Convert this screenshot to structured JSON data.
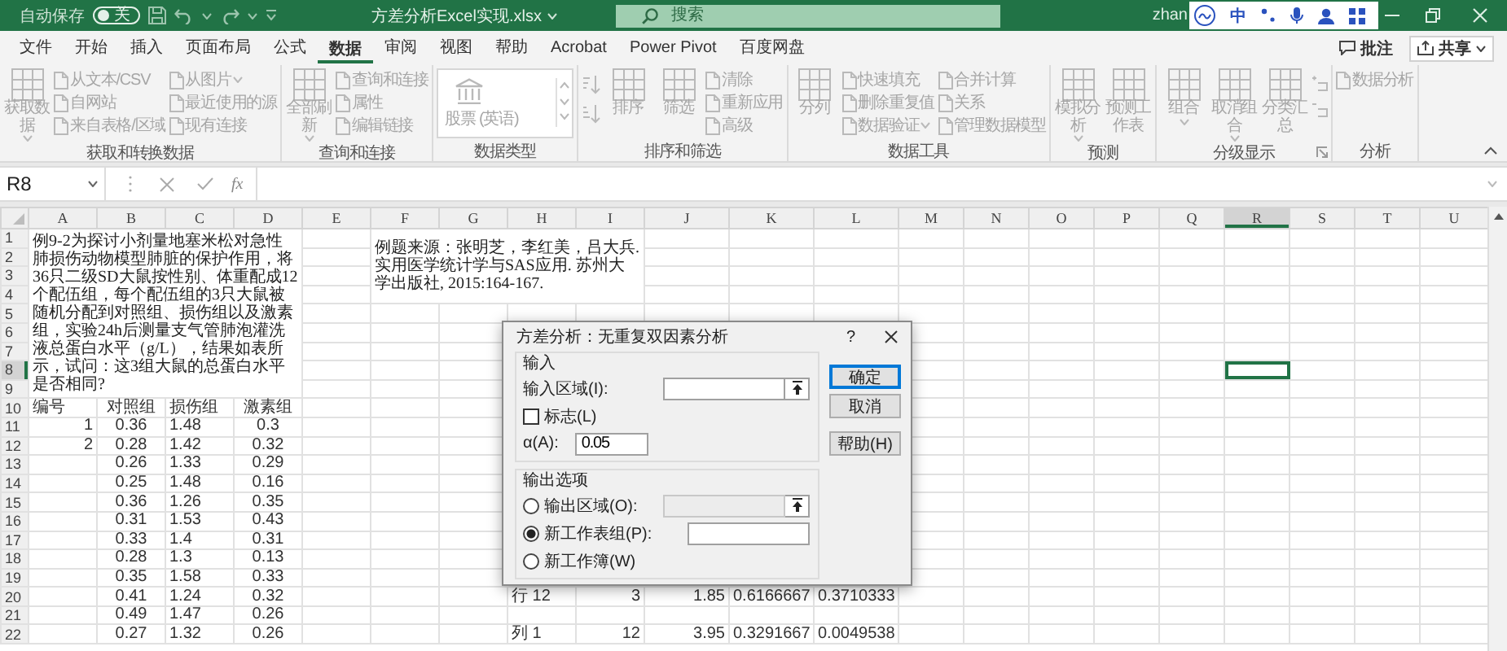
{
  "title_bar": {
    "autosave_label": "自动保存",
    "autosave_toggle": {
      "on": false,
      "label": "关"
    },
    "document_title": "方差分析Excel实现.xlsx",
    "search_placeholder": "搜索",
    "user": "zhan",
    "ime_mode": "中"
  },
  "menu_tabs": [
    {
      "label": "文件",
      "selected": false
    },
    {
      "label": "开始",
      "selected": false
    },
    {
      "label": "插入",
      "selected": false
    },
    {
      "label": "页面布局",
      "selected": false
    },
    {
      "label": "公式",
      "selected": false
    },
    {
      "label": "数据",
      "selected": true
    },
    {
      "label": "审阅",
      "selected": false
    },
    {
      "label": "视图",
      "selected": false
    },
    {
      "label": "帮助",
      "selected": false
    },
    {
      "label": "Acrobat",
      "selected": false
    },
    {
      "label": "Power Pivot",
      "selected": false
    },
    {
      "label": "百度网盘",
      "selected": false
    }
  ],
  "actions": [
    {
      "label": "批注",
      "kind": "comment"
    },
    {
      "label": "共享",
      "kind": "share"
    }
  ],
  "ribbon": {
    "disabled": true,
    "groups": [
      {
        "label": "获取和转换数据",
        "items": [
          {
            "kind": "large",
            "label": "获取数据",
            "dropdown": true
          },
          {
            "kind": "stack",
            "items": [
              {
                "label": "从文本/CSV"
              },
              {
                "label": "自网站"
              },
              {
                "label": "来自表格/区域"
              }
            ]
          },
          {
            "kind": "stack",
            "items": [
              {
                "label": "从图片",
                "dropdown": true
              },
              {
                "label": "最近使用的源"
              },
              {
                "label": "现有连接"
              }
            ]
          }
        ]
      },
      {
        "label": "查询和连接",
        "items": [
          {
            "kind": "large",
            "label": "全部刷新",
            "dropdown": true
          },
          {
            "kind": "stack",
            "items": [
              {
                "label": "查询和连接"
              },
              {
                "label": "属性"
              },
              {
                "label": "编辑链接"
              }
            ]
          }
        ]
      },
      {
        "label": "数据类型",
        "items": [
          {
            "kind": "gallery",
            "label": "股票 (英语)"
          }
        ]
      },
      {
        "label": "排序和筛选",
        "items": [
          {
            "kind": "sort-icons"
          },
          {
            "kind": "large",
            "label": "排序"
          },
          {
            "kind": "large",
            "label": "筛选"
          },
          {
            "kind": "stack",
            "items": [
              {
                "label": "清除"
              },
              {
                "label": "重新应用"
              },
              {
                "label": "高级"
              }
            ]
          }
        ]
      },
      {
        "label": "数据工具",
        "items": [
          {
            "kind": "large",
            "label": "分列"
          },
          {
            "kind": "stack",
            "items": [
              {
                "label": "快速填充"
              },
              {
                "label": "删除重复值"
              },
              {
                "label": "数据验证",
                "dropdown": true
              }
            ]
          },
          {
            "kind": "stack",
            "items": [
              {
                "label": "合并计算"
              },
              {
                "label": "关系"
              },
              {
                "label": "管理数据模型"
              }
            ]
          }
        ]
      },
      {
        "label": "预测",
        "items": [
          {
            "kind": "large",
            "label": "模拟分析",
            "dropdown": true
          },
          {
            "kind": "large",
            "label": "预测工作表"
          }
        ]
      },
      {
        "label": "分级显示",
        "dialog_launcher": true,
        "items": [
          {
            "kind": "large",
            "label": "组合",
            "dropdown": true
          },
          {
            "kind": "large",
            "label": "取消组合",
            "dropdown": true
          },
          {
            "kind": "large",
            "label": "分类汇总"
          },
          {
            "kind": "detail-icons"
          }
        ]
      },
      {
        "label": "分析",
        "items": [
          {
            "kind": "stack",
            "items": [
              {
                "label": "数据分析"
              }
            ]
          }
        ]
      }
    ]
  },
  "formula_bar": {
    "name_box": "R8",
    "function_button": "fx"
  },
  "sheet": {
    "columns": [
      {
        "label": "A",
        "selected": false
      },
      {
        "label": "B",
        "selected": false
      },
      {
        "label": "C",
        "selected": false
      },
      {
        "label": "D",
        "selected": false
      },
      {
        "label": "E",
        "selected": false
      },
      {
        "label": "F",
        "selected": false
      },
      {
        "label": "G",
        "selected": false
      },
      {
        "label": "H",
        "selected": false
      },
      {
        "label": "I",
        "selected": false
      },
      {
        "label": "J",
        "selected": false
      },
      {
        "label": "K",
        "selected": false
      },
      {
        "label": "L",
        "selected": false
      },
      {
        "label": "M",
        "selected": false
      },
      {
        "label": "N",
        "selected": false
      },
      {
        "label": "O",
        "selected": false
      },
      {
        "label": "P",
        "selected": false
      },
      {
        "label": "Q",
        "selected": false
      },
      {
        "label": "R",
        "selected": true
      },
      {
        "label": "S",
        "selected": false
      },
      {
        "label": "T",
        "selected": false
      },
      {
        "label": "U",
        "selected": false
      }
    ],
    "notes": [
      {
        "text": "例9-2为探讨小剂量地塞米松对急性肺损伤动物模型肺脏的保护作用，将36只二级SD大鼠按性别、体重配成12个配伍组，每个配伍组的3只大鼠被随机分配到对照组、损伤组以及激素组，实验24h后测量支气管肺泡灌洗液总蛋白水平（g/L），结果如表所示，试问：这3组大鼠的总蛋白水平是否相同?"
      },
      {
        "text": "例题来源：张明芝，李红美，吕大兵. 实用医学统计学与SAS应用. 苏州大学出版社, 2015:164-167."
      }
    ],
    "rows": [
      {
        "label": "1",
        "selected": false
      },
      {
        "label": "2",
        "selected": false
      },
      {
        "label": "3",
        "selected": false
      },
      {
        "label": "4",
        "selected": false
      },
      {
        "label": "5",
        "selected": false
      },
      {
        "label": "6",
        "selected": false
      },
      {
        "label": "7",
        "selected": false
      },
      {
        "label": "8",
        "selected": true
      },
      {
        "label": "9",
        "selected": false
      },
      {
        "label": "10",
        "selected": false,
        "cells": [
          {
            "text": "编号"
          },
          {
            "text": "对照组",
            "centered": true
          },
          {
            "text": "损伤组"
          },
          {
            "text": "激素组",
            "centered": true
          }
        ]
      },
      {
        "label": "11",
        "selected": false,
        "cells": [
          {
            "text": "1",
            "right_aligned": true
          },
          {
            "text": "0.36",
            "centered": true
          },
          {
            "text": "1.48"
          },
          {
            "text": "0.3",
            "centered": true
          }
        ]
      },
      {
        "label": "12",
        "selected": false,
        "cells": [
          {
            "text": "2",
            "right_aligned": true
          },
          {
            "text": "0.28",
            "centered": true
          },
          {
            "text": "1.42"
          },
          {
            "text": "0.32",
            "centered": true
          }
        ]
      },
      {
        "label": "13",
        "selected": false,
        "cells": [
          {},
          {
            "text": "0.26",
            "centered": true
          },
          {
            "text": "1.33"
          },
          {
            "text": "0.29",
            "centered": true
          }
        ]
      },
      {
        "label": "14",
        "selected": false,
        "cells": [
          {},
          {
            "text": "0.25",
            "centered": true
          },
          {
            "text": "1.48"
          },
          {
            "text": "0.16",
            "centered": true
          }
        ]
      },
      {
        "label": "15",
        "selected": false,
        "cells": [
          {},
          {
            "text": "0.36",
            "centered": true
          },
          {
            "text": "1.26"
          },
          {
            "text": "0.35",
            "centered": true
          }
        ]
      },
      {
        "label": "16",
        "selected": false,
        "cells": [
          {},
          {
            "text": "0.31",
            "centered": true
          },
          {
            "text": "1.53"
          },
          {
            "text": "0.43",
            "centered": true
          }
        ]
      },
      {
        "label": "17",
        "selected": false,
        "cells": [
          {},
          {
            "text": "0.33",
            "centered": true
          },
          {
            "text": "1.4"
          },
          {
            "text": "0.31",
            "centered": true
          }
        ]
      },
      {
        "label": "18",
        "selected": false,
        "cells": [
          {},
          {
            "text": "0.28",
            "centered": true
          },
          {
            "text": "1.3"
          },
          {
            "text": "0.13",
            "centered": true
          }
        ]
      },
      {
        "label": "19",
        "selected": false,
        "cells": [
          {},
          {
            "text": "0.35",
            "centered": true
          },
          {
            "text": "1.58"
          },
          {
            "text": "0.33",
            "centered": true
          }
        ]
      },
      {
        "label": "20",
        "selected": false,
        "cells": [
          {},
          {
            "text": "0.41",
            "centered": true
          },
          {
            "text": "1.24"
          },
          {
            "text": "0.32",
            "centered": true
          },
          {},
          {},
          {},
          {
            "text": "行 12"
          },
          {
            "text": "3",
            "right_aligned": true
          },
          {
            "text": "1.85",
            "right_aligned": true
          },
          {
            "text": "0.6166667",
            "right_aligned": true
          },
          {
            "text": "0.3710333",
            "right_aligned": true
          }
        ]
      },
      {
        "label": "21",
        "selected": false,
        "cells": [
          {},
          {
            "text": "0.49",
            "centered": true
          },
          {
            "text": "1.47"
          },
          {
            "text": "0.26",
            "centered": true
          }
        ]
      },
      {
        "label": "22",
        "selected": false,
        "cells": [
          {},
          {
            "text": "0.27",
            "centered": true
          },
          {
            "text": "1.32"
          },
          {
            "text": "0.26",
            "centered": true
          },
          {},
          {},
          {},
          {
            "text": "列 1"
          },
          {
            "text": "12",
            "right_aligned": true
          },
          {
            "text": "3.95",
            "right_aligned": true
          },
          {
            "text": "0.3291667",
            "right_aligned": true
          },
          {
            "text": "0.0049538",
            "right_aligned": true
          }
        ]
      }
    ]
  },
  "dialog": {
    "title": "方差分析：无重复双因素分析",
    "help_glyph": "?",
    "input_section": {
      "heading": "输入",
      "range": {
        "label": "输入区域(I):"
      },
      "labels_checkbox": {
        "label": "标志(L)",
        "checked": false
      },
      "alpha": {
        "label": "α(A):",
        "value": "0.05"
      }
    },
    "output_section": {
      "heading": "输出选项",
      "options": [
        {
          "label": "输出区域(O):",
          "selected": false,
          "field": {
            "disabled": true,
            "collapse_button": true
          }
        },
        {
          "label": "新工作表组(P):",
          "selected": true,
          "field": {
            "disabled": false
          }
        },
        {
          "label": "新工作簿(W)",
          "selected": false
        }
      ]
    },
    "buttons": [
      {
        "label": "确定",
        "default": true
      },
      {
        "label": "取消",
        "default": false
      },
      {
        "label": "帮助(H)",
        "default": false
      }
    ]
  }
}
